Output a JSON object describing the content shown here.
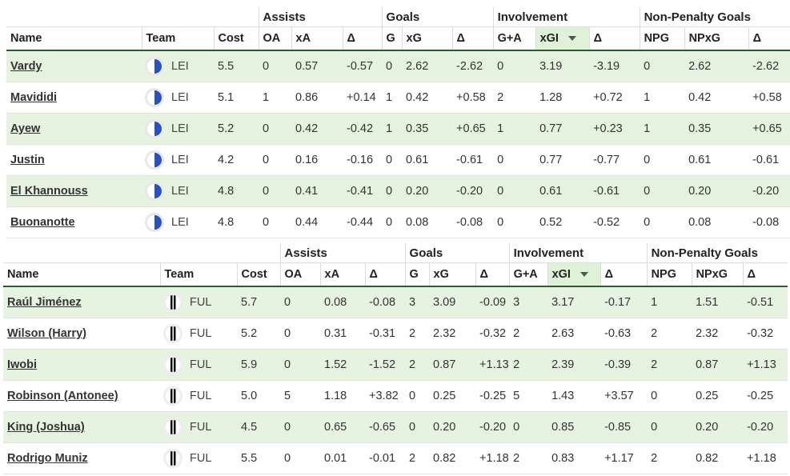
{
  "groups": {
    "assists": "Assists",
    "goals": "Goals",
    "involvement": "Involvement",
    "npg": "Non-Penalty Goals"
  },
  "columns": {
    "name": "Name",
    "team": "Team",
    "cost": "Cost",
    "oa": "OA",
    "xa": "xA",
    "delta": "Δ",
    "g": "G",
    "xg": "xG",
    "ga": "G+A",
    "xgi": "xGI",
    "npg": "NPG",
    "npxg": "NPxG"
  },
  "tables": [
    {
      "rows": [
        {
          "name": "Vardy",
          "team": "LEI",
          "crest": "leicester-crest-icon",
          "cost": "5.5",
          "oa": "0",
          "xa": "0.57",
          "da": "-0.57",
          "g": "0",
          "xg": "2.62",
          "dg": "-2.62",
          "ga": "0",
          "xgi": "3.19",
          "dgi": "-3.19",
          "npg": "0",
          "npxg": "2.62",
          "dnp": "-2.62"
        },
        {
          "name": "Mavididi",
          "team": "LEI",
          "crest": "leicester-crest-icon",
          "cost": "5.1",
          "oa": "1",
          "xa": "0.86",
          "da": "+0.14",
          "g": "1",
          "xg": "0.42",
          "dg": "+0.58",
          "ga": "2",
          "xgi": "1.28",
          "dgi": "+0.72",
          "npg": "1",
          "npxg": "0.42",
          "dnp": "+0.58"
        },
        {
          "name": "Ayew",
          "team": "LEI",
          "crest": "leicester-crest-icon",
          "cost": "5.2",
          "oa": "0",
          "xa": "0.42",
          "da": "-0.42",
          "g": "1",
          "xg": "0.35",
          "dg": "+0.65",
          "ga": "1",
          "xgi": "0.77",
          "dgi": "+0.23",
          "npg": "1",
          "npxg": "0.35",
          "dnp": "+0.65"
        },
        {
          "name": "Justin",
          "team": "LEI",
          "crest": "leicester-crest-icon",
          "cost": "4.2",
          "oa": "0",
          "xa": "0.16",
          "da": "-0.16",
          "g": "0",
          "xg": "0.61",
          "dg": "-0.61",
          "ga": "0",
          "xgi": "0.77",
          "dgi": "-0.77",
          "npg": "0",
          "npxg": "0.61",
          "dnp": "-0.61"
        },
        {
          "name": "El Khannouss",
          "team": "LEI",
          "crest": "leicester-crest-icon",
          "cost": "4.8",
          "oa": "0",
          "xa": "0.41",
          "da": "-0.41",
          "g": "0",
          "xg": "0.20",
          "dg": "-0.20",
          "ga": "0",
          "xgi": "0.61",
          "dgi": "-0.61",
          "npg": "0",
          "npxg": "0.20",
          "dnp": "-0.20"
        },
        {
          "name": "Buonanotte",
          "team": "LEI",
          "crest": "leicester-crest-icon",
          "cost": "4.8",
          "oa": "0",
          "xa": "0.44",
          "da": "-0.44",
          "g": "0",
          "xg": "0.08",
          "dg": "-0.08",
          "ga": "0",
          "xgi": "0.52",
          "dgi": "-0.52",
          "npg": "0",
          "npxg": "0.08",
          "dnp": "-0.08"
        }
      ]
    },
    {
      "rows": [
        {
          "name": "Raúl Jiménez",
          "team": "FUL",
          "crest": "fulham-crest-icon",
          "cost": "5.7",
          "oa": "0",
          "xa": "0.08",
          "da": "-0.08",
          "g": "3",
          "xg": "3.09",
          "dg": "-0.09",
          "ga": "3",
          "xgi": "3.17",
          "dgi": "-0.17",
          "npg": "1",
          "npxg": "1.51",
          "dnp": "-0.51"
        },
        {
          "name": "Wilson (Harry)",
          "team": "FUL",
          "crest": "fulham-crest-icon",
          "cost": "5.2",
          "oa": "0",
          "xa": "0.31",
          "da": "-0.31",
          "g": "2",
          "xg": "2.32",
          "dg": "-0.32",
          "ga": "2",
          "xgi": "2.63",
          "dgi": "-0.63",
          "npg": "2",
          "npxg": "2.32",
          "dnp": "-0.32"
        },
        {
          "name": "Iwobi",
          "team": "FUL",
          "crest": "fulham-crest-icon",
          "cost": "5.9",
          "oa": "0",
          "xa": "1.52",
          "da": "-1.52",
          "g": "2",
          "xg": "0.87",
          "dg": "+1.13",
          "ga": "2",
          "xgi": "2.39",
          "dgi": "-0.39",
          "npg": "2",
          "npxg": "0.87",
          "dnp": "+1.13"
        },
        {
          "name": "Robinson (Antonee)",
          "team": "FUL",
          "crest": "fulham-crest-icon",
          "cost": "5.0",
          "oa": "5",
          "xa": "1.18",
          "da": "+3.82",
          "g": "0",
          "xg": "0.25",
          "dg": "-0.25",
          "ga": "5",
          "xgi": "1.43",
          "dgi": "+3.57",
          "npg": "0",
          "npxg": "0.25",
          "dnp": "-0.25"
        },
        {
          "name": "King (Joshua)",
          "team": "FUL",
          "crest": "fulham-crest-icon",
          "cost": "4.5",
          "oa": "0",
          "xa": "0.65",
          "da": "-0.65",
          "g": "0",
          "xg": "0.20",
          "dg": "-0.20",
          "ga": "0",
          "xgi": "0.85",
          "dgi": "-0.85",
          "npg": "0",
          "npxg": "0.20",
          "dnp": "-0.20"
        },
        {
          "name": "Rodrigo Muniz",
          "team": "FUL",
          "crest": "fulham-crest-icon",
          "cost": "5.5",
          "oa": "0",
          "xa": "0.01",
          "da": "-0.01",
          "g": "2",
          "xg": "0.82",
          "dg": "+1.18",
          "ga": "2",
          "xgi": "0.83",
          "dgi": "+1.17",
          "npg": "2",
          "npxg": "0.82",
          "dnp": "+1.18"
        }
      ]
    }
  ]
}
